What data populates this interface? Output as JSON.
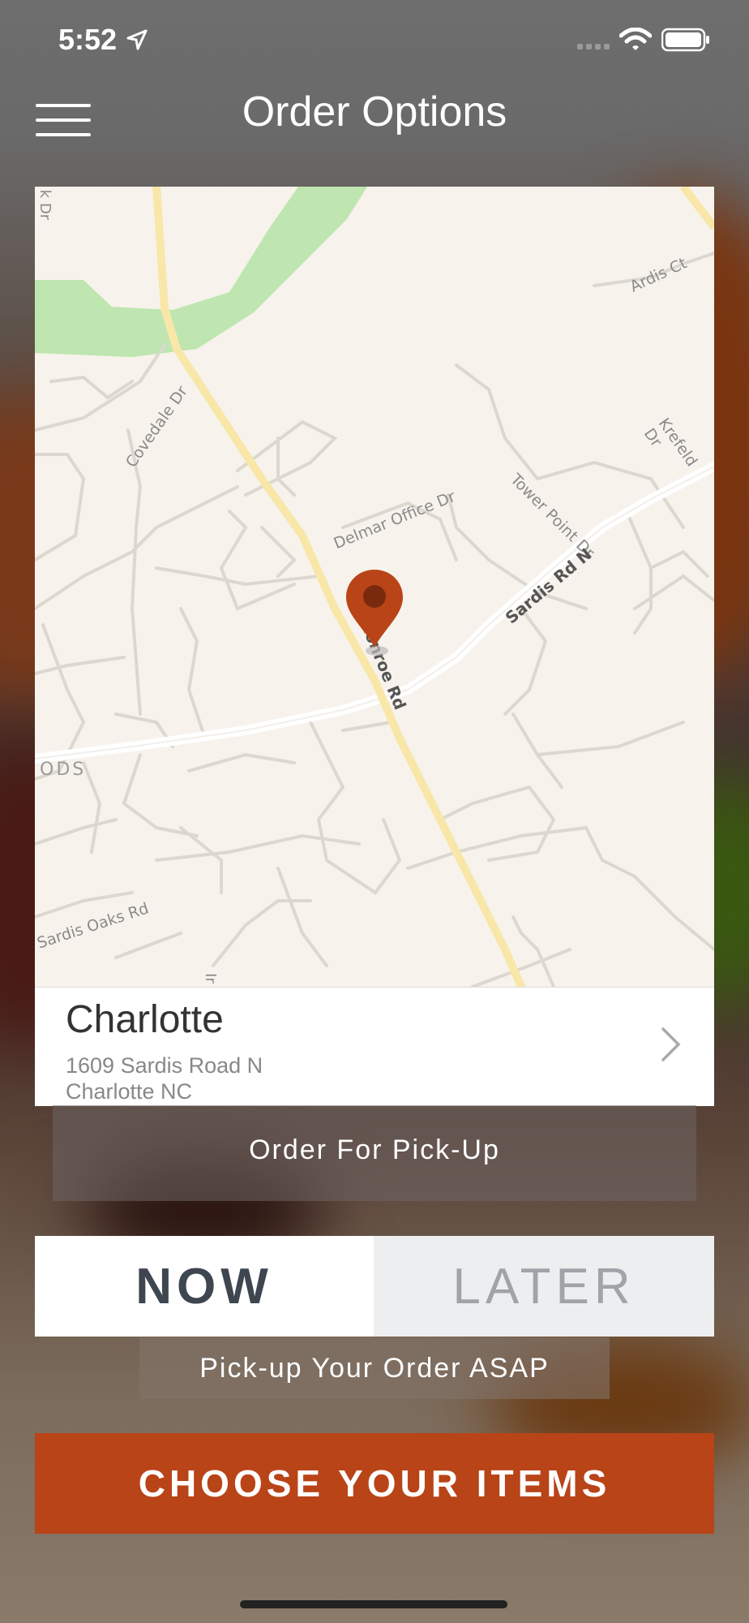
{
  "status": {
    "time": "5:52"
  },
  "nav": {
    "title": "Order Options",
    "menu_icon": "hamburger-icon"
  },
  "map": {
    "labels": {
      "kdr": "k Dr",
      "ardis": "Ardis Ct",
      "covedale": "Covedale Dr",
      "krefeld": "Krefeld Dr",
      "delmar": "Delmar Office Dr",
      "tower": "Tower Point Dr",
      "sardisn": "Sardis Rd N",
      "monroe": "Monroe Rd",
      "ods": "ODS",
      "sardisoaks": "Sardis Oaks Rd",
      "ir": "Ir"
    },
    "pin_color": "#b84418"
  },
  "location": {
    "city": "Charlotte",
    "address_line1": "1609 Sardis Road N",
    "address_line2": "Charlotte NC"
  },
  "order_type": {
    "label": "Order For Pick-Up"
  },
  "timing": {
    "now_label": "NOW",
    "later_label": "LATER",
    "selected": "NOW",
    "note": "Pick-up Your Order ASAP"
  },
  "cta": {
    "label": "CHOOSE YOUR ITEMS"
  },
  "colors": {
    "accent": "#b84418",
    "segment_text": "#3e4650"
  }
}
